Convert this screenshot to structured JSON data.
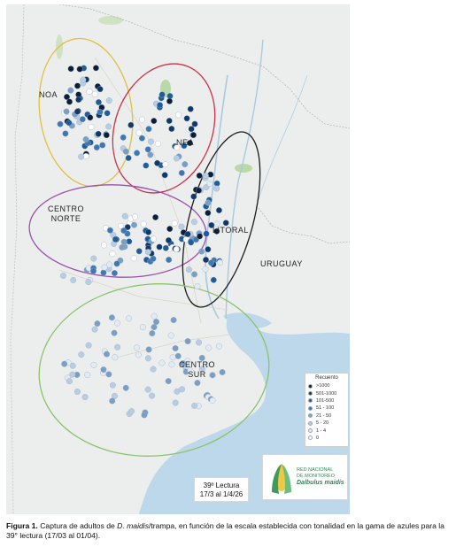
{
  "map": {
    "regions": [
      {
        "label": "NOA",
        "color": "#e0c040"
      },
      {
        "label": "NEA",
        "color": "#c8324a"
      },
      {
        "label": "CENTRO\nNORTE",
        "color": "#9a4fb0"
      },
      {
        "label": "LITORAL",
        "color": "#1c1c1c"
      },
      {
        "label": "URUGUAY",
        "color": null
      },
      {
        "label": "CENTRO\nSUR",
        "color": "#8ac46a"
      }
    ],
    "point_colors": {
      ">1000": "#0b1f3a",
      "501-1000": "#12386a",
      "101-500": "#1f5c99",
      "51-100": "#3d78b0",
      "21-50": "#7a9fc4",
      "5-20": "#b7cde3",
      "1-4": "#e2ebf4",
      "0": "#ffffff"
    }
  },
  "legend": {
    "title": "Recuento",
    "items": [
      {
        "label": ">1000",
        "color": "#0b1f3a"
      },
      {
        "label": "501-1000",
        "color": "#12386a"
      },
      {
        "label": "101-500",
        "color": "#1f5c99"
      },
      {
        "label": "51 - 100",
        "color": "#3d78b0"
      },
      {
        "label": "21 - 50",
        "color": "#7a9fc4"
      },
      {
        "label": "5 - 20",
        "color": "#b7cde3"
      },
      {
        "label": "1 - 4",
        "color": "#e2ebf4"
      },
      {
        "label": "0",
        "color": "#ffffff"
      }
    ]
  },
  "lectura": {
    "line1": "39º Lectura",
    "line2": "17/3 al 1/4/26"
  },
  "logo": {
    "line1": "RED NACIONAL",
    "line2": "DE MONITOREO",
    "line3": "Dalbulus maidis"
  },
  "caption": {
    "fig": "Figura 1.",
    "text_a": " Captura de adultos de ",
    "species": "D. maidis",
    "text_b": "/trampa, en función de la escala establecida con tonalidad en la gama de azules para la 39° lectura (17/03 al 01/04)."
  }
}
